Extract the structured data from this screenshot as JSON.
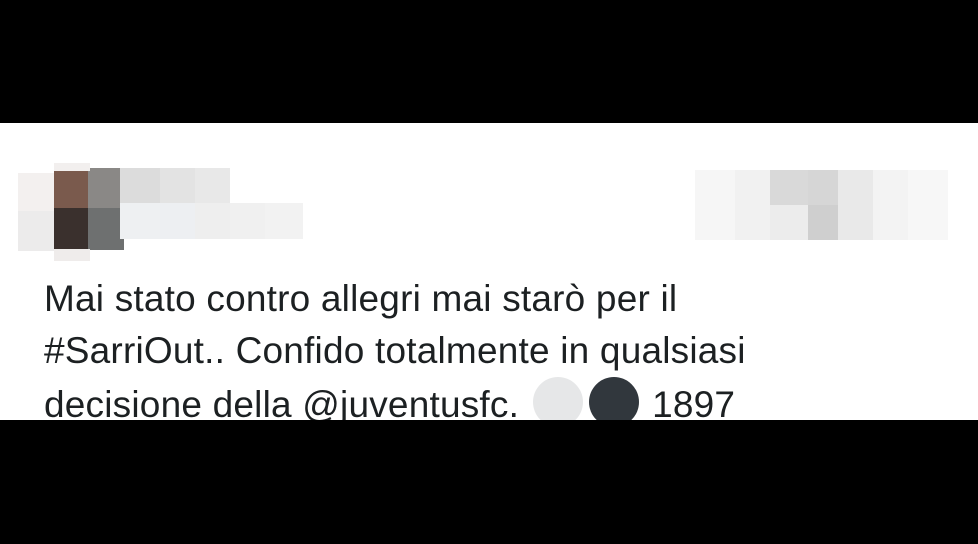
{
  "tweet": {
    "author_avatar": "avatar-pixelated",
    "line1": "Mai stato contro allegri mai starò per il",
    "line2": "#SarriOut.. Confido totalmente in qualsiasi",
    "line3_prefix": "decisione della @juventusfc.",
    "line3_suffix": "1897",
    "emoji": [
      {
        "name": "white-circle-icon",
        "color": "#e6e7e8"
      },
      {
        "name": "black-circle-icon",
        "color": "#31373d"
      }
    ]
  },
  "colors": {
    "background": "#000000",
    "card": "#ffffff",
    "text": "#1c2022"
  }
}
